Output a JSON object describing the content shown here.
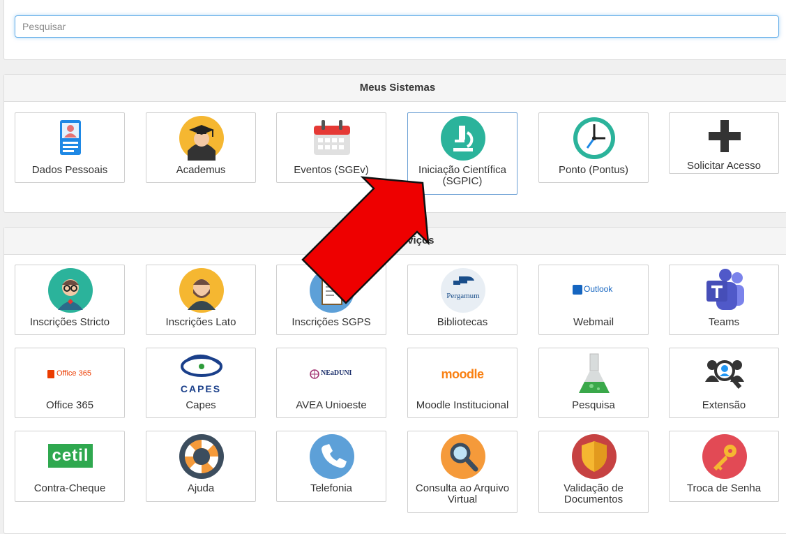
{
  "search": {
    "placeholder": "Pesquisar"
  },
  "sistemas": {
    "title": "Meus Sistemas",
    "items": [
      {
        "label": "Dados Pessoais",
        "icon": "id-card-icon"
      },
      {
        "label": "Academus",
        "icon": "graduate-icon"
      },
      {
        "label": "Eventos (SGEv)",
        "icon": "calendar-icon"
      },
      {
        "label": "Iniciação Científica (SGPIC)",
        "icon": "microscope-icon"
      },
      {
        "label": "Ponto (Pontus)",
        "icon": "clock-icon"
      },
      {
        "label": "Solicitar Acesso",
        "icon": "plus-icon"
      }
    ]
  },
  "servicos": {
    "title": "Meus Serviços",
    "items": [
      {
        "label": "Inscrições Stricto",
        "icon": "professor-icon"
      },
      {
        "label": "Inscrições Lato",
        "icon": "bearded-man-icon"
      },
      {
        "label": "Inscrições SGPS",
        "icon": "document-icon"
      },
      {
        "label": "Bibliotecas",
        "icon": "pergamum-logo",
        "logo_text": "Pergamum"
      },
      {
        "label": "Webmail",
        "icon": "outlook-logo",
        "logo_text": "Outlook"
      },
      {
        "label": "Teams",
        "icon": "teams-logo"
      },
      {
        "label": "Office 365",
        "icon": "office365-logo",
        "logo_text": "Office 365"
      },
      {
        "label": "Capes",
        "icon": "capes-logo",
        "logo_text": "CAPES"
      },
      {
        "label": "AVEA Unioeste",
        "icon": "neaduni-logo",
        "logo_text": "NEaDUNI"
      },
      {
        "label": "Moodle Institucional",
        "icon": "moodle-logo",
        "logo_text": "moodle"
      },
      {
        "label": "Pesquisa",
        "icon": "flask-icon"
      },
      {
        "label": "Extensão",
        "icon": "people-group-icon"
      },
      {
        "label": "Contra-Cheque",
        "icon": "cetil-logo",
        "logo_text": "cetil"
      },
      {
        "label": "Ajuda",
        "icon": "lifebuoy-icon"
      },
      {
        "label": "Telefonia",
        "icon": "phone-icon"
      },
      {
        "label": "Consulta ao Arquivo Virtual",
        "icon": "magnifier-icon"
      },
      {
        "label": "Validação de Documentos",
        "icon": "shield-icon"
      },
      {
        "label": "Troca de Senha",
        "icon": "key-icon"
      }
    ]
  },
  "colors": {
    "focus_border": "#66afe9",
    "active_tile_border": "#6a9fd4",
    "arrow_fill": "#ee0000",
    "teal": "#2bb39b",
    "orange": "#f5b731"
  }
}
